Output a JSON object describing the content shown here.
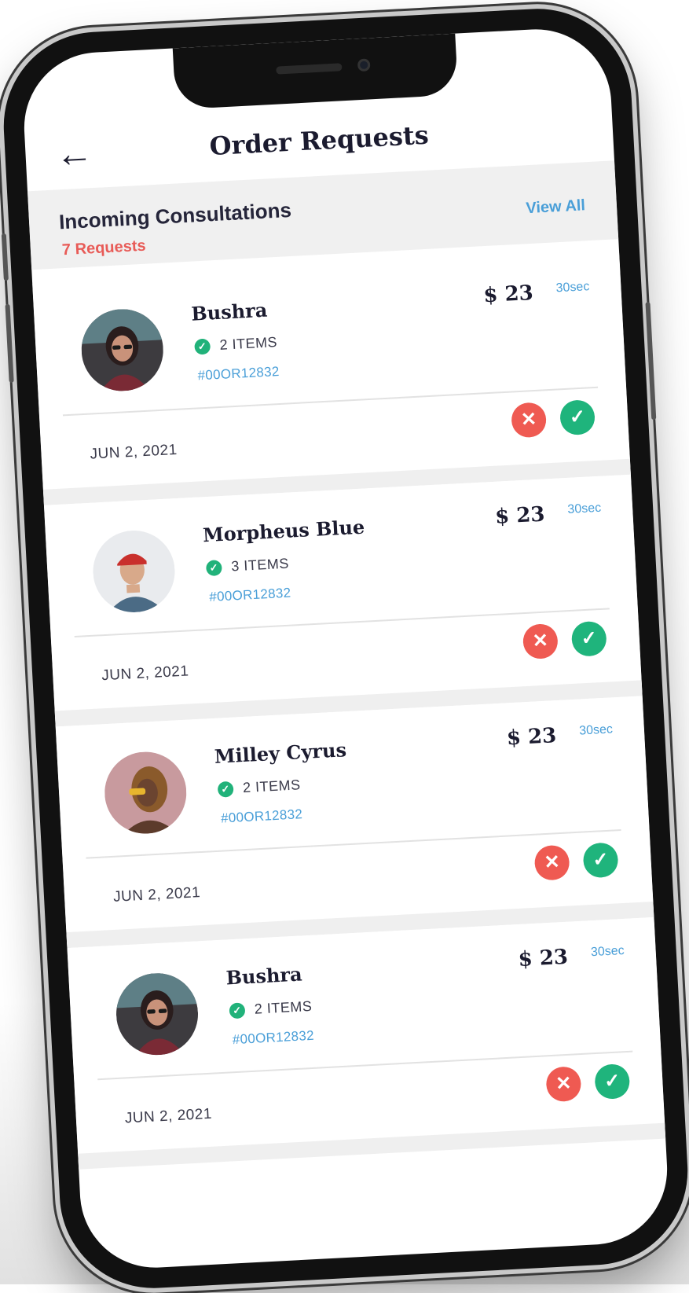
{
  "header": {
    "back_icon": "arrow-left-icon",
    "title": "Order Requests"
  },
  "section": {
    "title": "Incoming Consultations",
    "requests_count": "7 Requests",
    "view_all": "View All"
  },
  "orders": [
    {
      "name": "Bushra",
      "items": "2 ITEMS",
      "order_id": "#00OR12832",
      "price": "$ 23",
      "timer": "30sec",
      "date": "JUN 2, 2021",
      "avatar": "woman-glasses-avatar"
    },
    {
      "name": "Morpheus Blue",
      "items": "3 ITEMS",
      "order_id": "#00OR12832",
      "price": "$ 23",
      "timer": "30sec",
      "date": "JUN 2, 2021",
      "avatar": "man-red-cap-avatar"
    },
    {
      "name": "Milley Cyrus",
      "items": "2 ITEMS",
      "order_id": "#00OR12832",
      "price": "$ 23",
      "timer": "30sec",
      "date": "JUN 2, 2021",
      "avatar": "woman-braids-avatar"
    },
    {
      "name": "Bushra",
      "items": "2 ITEMS",
      "order_id": "#00OR12832",
      "price": "$ 23",
      "timer": "30sec",
      "date": "JUN 2, 2021",
      "avatar": "woman-glasses-avatar"
    }
  ],
  "icons": {
    "check": "check-icon",
    "reject": "close-icon",
    "accept": "checkmark-icon"
  },
  "colors": {
    "reject": "#ef5a52",
    "accept": "#1fb47c",
    "accent_blue": "#4a9fd8",
    "accent_red": "#e85b57"
  }
}
